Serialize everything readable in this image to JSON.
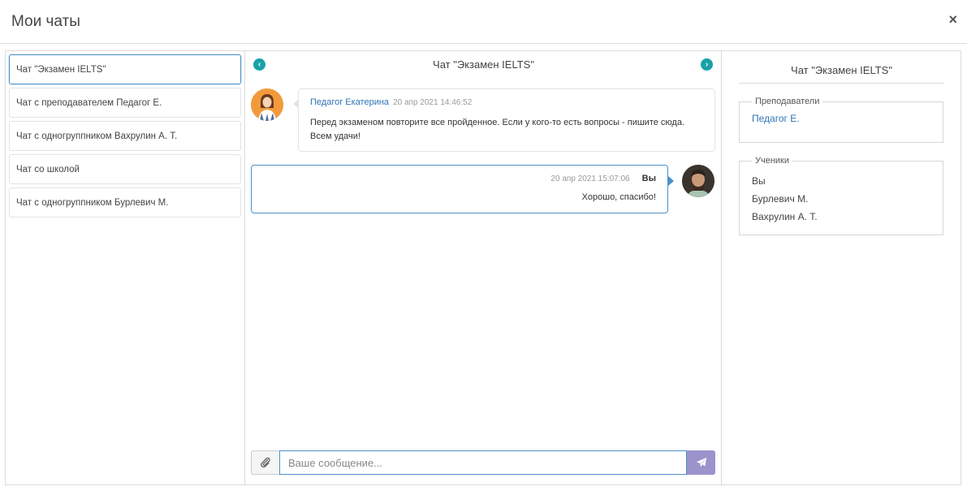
{
  "modal": {
    "title": "Мои чаты",
    "close_label": "×"
  },
  "chat_list": {
    "items": [
      {
        "label": "Чат \"Экзамен IELTS\"",
        "active": true
      },
      {
        "label": "Чат с преподавателем Педагог Е.",
        "active": false
      },
      {
        "label": "Чат с одногруппником Вахрулин А. Т.",
        "active": false
      },
      {
        "label": "Чат со школой",
        "active": false
      },
      {
        "label": "Чат с одногруппником Бурлевич М.",
        "active": false
      }
    ]
  },
  "chat": {
    "title": "Чат \"Экзамен IELTS\"",
    "prev_icon": "chevron-left-icon",
    "next_icon": "chevron-right-icon",
    "messages": [
      {
        "author": "Педагог Екатерина",
        "time": "20 апр 2021 14:46:52",
        "text": "Перед экзаменом повторите все пройденное. Если у кого-то есть вопросы - пишите сюда. Всем удачи!",
        "direction": "incoming"
      },
      {
        "author": "Вы",
        "time": "20 апр 2021 15:07:06",
        "text": "Хорошо, спасибо!",
        "direction": "outgoing"
      }
    ],
    "composer": {
      "placeholder": "Ваше сообщение...",
      "attach_icon": "paperclip-icon",
      "send_icon": "paper-plane-icon"
    }
  },
  "info": {
    "title": "Чат \"Экзамен IELTS\"",
    "teachers_legend": "Преподаватели",
    "teachers": [
      "Педагог Е."
    ],
    "students_legend": "Ученики",
    "students": [
      "Вы",
      "Бурлевич М.",
      "Вахрулин А. Т."
    ]
  },
  "colors": {
    "accent_blue": "#4a90c9",
    "nav_teal": "#17a2a8",
    "send_purple": "#9b93cc",
    "link_blue": "#2e74b5"
  }
}
